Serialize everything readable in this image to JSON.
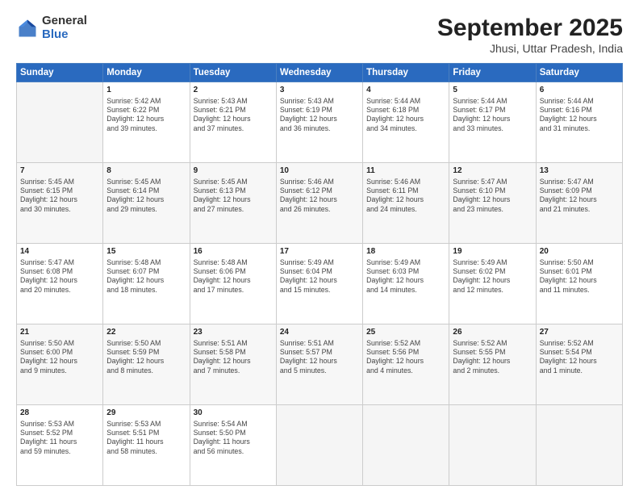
{
  "logo": {
    "general": "General",
    "blue": "Blue"
  },
  "title": {
    "month": "September 2025",
    "location": "Jhusi, Uttar Pradesh, India"
  },
  "days": [
    "Sunday",
    "Monday",
    "Tuesday",
    "Wednesday",
    "Thursday",
    "Friday",
    "Saturday"
  ],
  "weeks": [
    [
      {
        "num": "",
        "info": ""
      },
      {
        "num": "1",
        "info": "Sunrise: 5:42 AM\nSunset: 6:22 PM\nDaylight: 12 hours\nand 39 minutes."
      },
      {
        "num": "2",
        "info": "Sunrise: 5:43 AM\nSunset: 6:21 PM\nDaylight: 12 hours\nand 37 minutes."
      },
      {
        "num": "3",
        "info": "Sunrise: 5:43 AM\nSunset: 6:19 PM\nDaylight: 12 hours\nand 36 minutes."
      },
      {
        "num": "4",
        "info": "Sunrise: 5:44 AM\nSunset: 6:18 PM\nDaylight: 12 hours\nand 34 minutes."
      },
      {
        "num": "5",
        "info": "Sunrise: 5:44 AM\nSunset: 6:17 PM\nDaylight: 12 hours\nand 33 minutes."
      },
      {
        "num": "6",
        "info": "Sunrise: 5:44 AM\nSunset: 6:16 PM\nDaylight: 12 hours\nand 31 minutes."
      }
    ],
    [
      {
        "num": "7",
        "info": "Sunrise: 5:45 AM\nSunset: 6:15 PM\nDaylight: 12 hours\nand 30 minutes."
      },
      {
        "num": "8",
        "info": "Sunrise: 5:45 AM\nSunset: 6:14 PM\nDaylight: 12 hours\nand 29 minutes."
      },
      {
        "num": "9",
        "info": "Sunrise: 5:45 AM\nSunset: 6:13 PM\nDaylight: 12 hours\nand 27 minutes."
      },
      {
        "num": "10",
        "info": "Sunrise: 5:46 AM\nSunset: 6:12 PM\nDaylight: 12 hours\nand 26 minutes."
      },
      {
        "num": "11",
        "info": "Sunrise: 5:46 AM\nSunset: 6:11 PM\nDaylight: 12 hours\nand 24 minutes."
      },
      {
        "num": "12",
        "info": "Sunrise: 5:47 AM\nSunset: 6:10 PM\nDaylight: 12 hours\nand 23 minutes."
      },
      {
        "num": "13",
        "info": "Sunrise: 5:47 AM\nSunset: 6:09 PM\nDaylight: 12 hours\nand 21 minutes."
      }
    ],
    [
      {
        "num": "14",
        "info": "Sunrise: 5:47 AM\nSunset: 6:08 PM\nDaylight: 12 hours\nand 20 minutes."
      },
      {
        "num": "15",
        "info": "Sunrise: 5:48 AM\nSunset: 6:07 PM\nDaylight: 12 hours\nand 18 minutes."
      },
      {
        "num": "16",
        "info": "Sunrise: 5:48 AM\nSunset: 6:06 PM\nDaylight: 12 hours\nand 17 minutes."
      },
      {
        "num": "17",
        "info": "Sunrise: 5:49 AM\nSunset: 6:04 PM\nDaylight: 12 hours\nand 15 minutes."
      },
      {
        "num": "18",
        "info": "Sunrise: 5:49 AM\nSunset: 6:03 PM\nDaylight: 12 hours\nand 14 minutes."
      },
      {
        "num": "19",
        "info": "Sunrise: 5:49 AM\nSunset: 6:02 PM\nDaylight: 12 hours\nand 12 minutes."
      },
      {
        "num": "20",
        "info": "Sunrise: 5:50 AM\nSunset: 6:01 PM\nDaylight: 12 hours\nand 11 minutes."
      }
    ],
    [
      {
        "num": "21",
        "info": "Sunrise: 5:50 AM\nSunset: 6:00 PM\nDaylight: 12 hours\nand 9 minutes."
      },
      {
        "num": "22",
        "info": "Sunrise: 5:50 AM\nSunset: 5:59 PM\nDaylight: 12 hours\nand 8 minutes."
      },
      {
        "num": "23",
        "info": "Sunrise: 5:51 AM\nSunset: 5:58 PM\nDaylight: 12 hours\nand 7 minutes."
      },
      {
        "num": "24",
        "info": "Sunrise: 5:51 AM\nSunset: 5:57 PM\nDaylight: 12 hours\nand 5 minutes."
      },
      {
        "num": "25",
        "info": "Sunrise: 5:52 AM\nSunset: 5:56 PM\nDaylight: 12 hours\nand 4 minutes."
      },
      {
        "num": "26",
        "info": "Sunrise: 5:52 AM\nSunset: 5:55 PM\nDaylight: 12 hours\nand 2 minutes."
      },
      {
        "num": "27",
        "info": "Sunrise: 5:52 AM\nSunset: 5:54 PM\nDaylight: 12 hours\nand 1 minute."
      }
    ],
    [
      {
        "num": "28",
        "info": "Sunrise: 5:53 AM\nSunset: 5:52 PM\nDaylight: 11 hours\nand 59 minutes."
      },
      {
        "num": "29",
        "info": "Sunrise: 5:53 AM\nSunset: 5:51 PM\nDaylight: 11 hours\nand 58 minutes."
      },
      {
        "num": "30",
        "info": "Sunrise: 5:54 AM\nSunset: 5:50 PM\nDaylight: 11 hours\nand 56 minutes."
      },
      {
        "num": "",
        "info": ""
      },
      {
        "num": "",
        "info": ""
      },
      {
        "num": "",
        "info": ""
      },
      {
        "num": "",
        "info": ""
      }
    ]
  ]
}
